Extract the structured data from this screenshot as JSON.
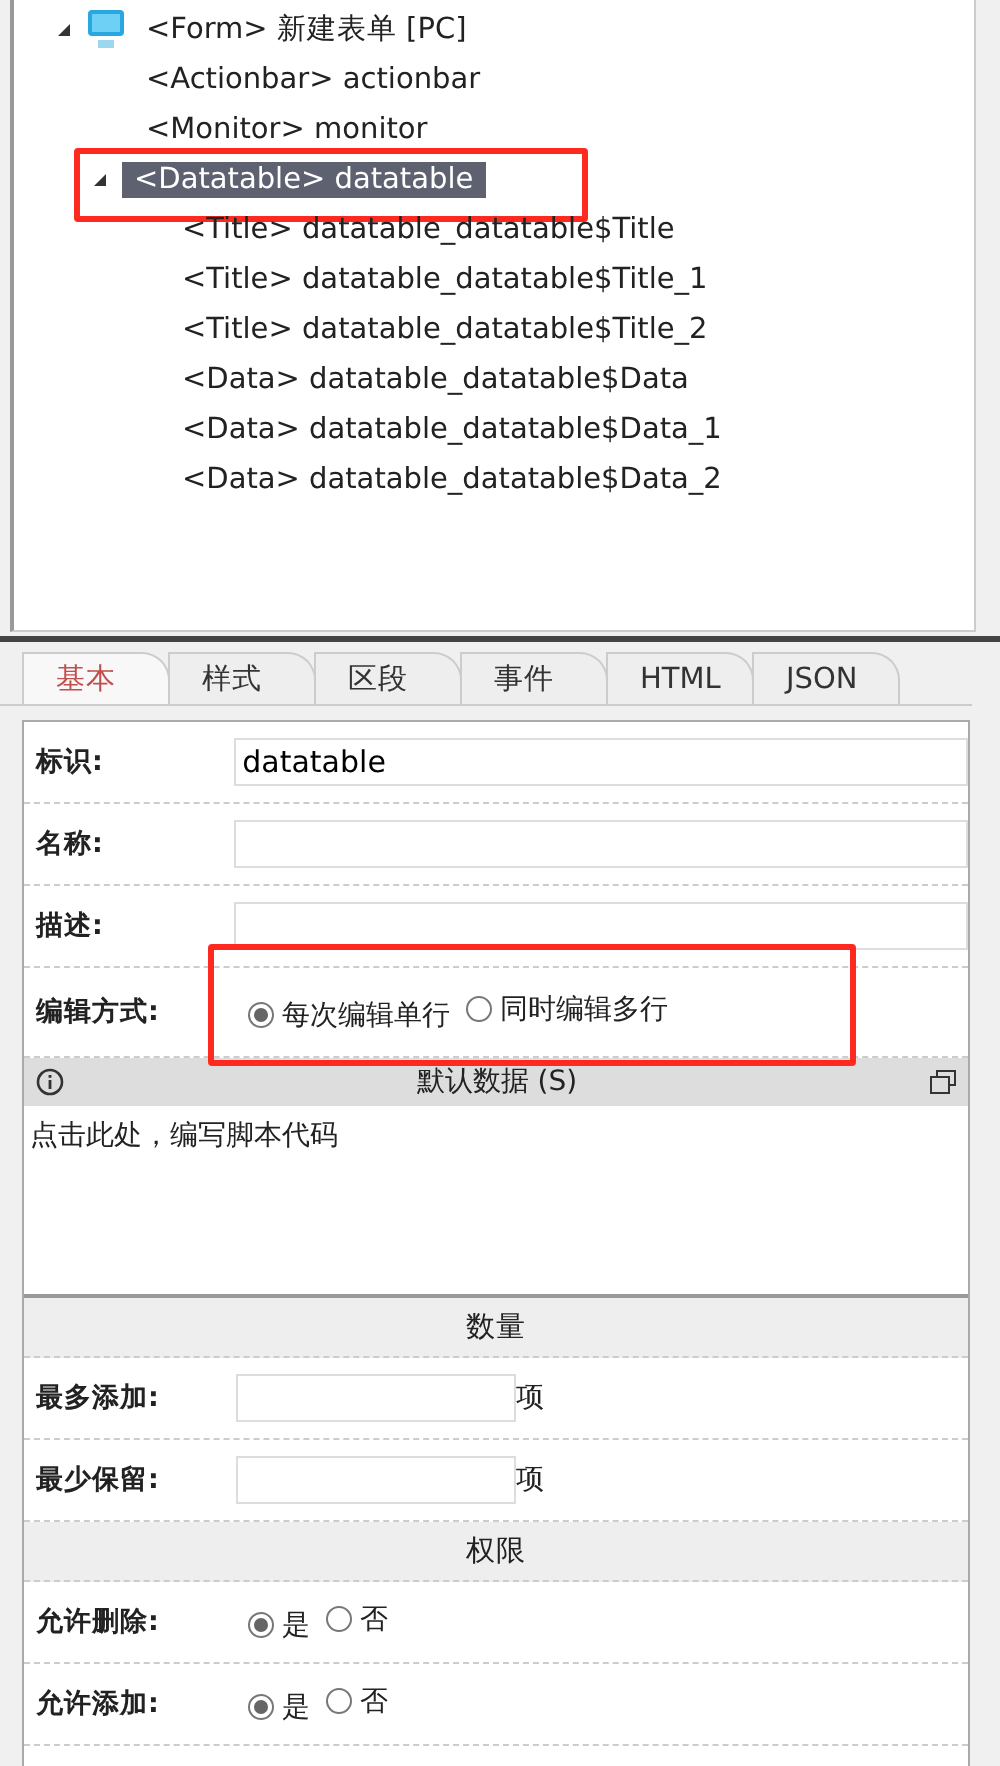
{
  "tree": {
    "items": [
      {
        "label": "<Form> 新建表单 [PC]",
        "expanded": true,
        "selected": false,
        "highlighted": false,
        "children": [
          {
            "label": "<Actionbar> actionbar",
            "selected": false,
            "highlighted": false
          },
          {
            "label": "<Monitor> monitor",
            "selected": false,
            "highlighted": false
          },
          {
            "label": "<Datatable> datatable",
            "expanded": true,
            "selected": true,
            "highlighted": true,
            "children": [
              {
                "label": "<Title> datatable_datatable$Title",
                "selected": false,
                "highlighted": false
              },
              {
                "label": "<Title> datatable_datatable$Title_1",
                "selected": false,
                "highlighted": false
              },
              {
                "label": "<Title> datatable_datatable$Title_2",
                "selected": false,
                "highlighted": false
              },
              {
                "label": "<Data> datatable_datatable$Data",
                "selected": false,
                "highlighted": false
              },
              {
                "label": "<Data> datatable_datatable$Data_1",
                "selected": false,
                "highlighted": false
              },
              {
                "label": "<Data> datatable_datatable$Data_2",
                "selected": false,
                "highlighted": false
              }
            ]
          }
        ]
      }
    ]
  },
  "tabs": [
    {
      "label": "基本",
      "selected": true
    },
    {
      "label": "样式",
      "selected": false
    },
    {
      "label": "区段",
      "selected": false
    },
    {
      "label": "事件",
      "selected": false
    },
    {
      "label": "HTML",
      "selected": false
    },
    {
      "label": "JSON",
      "selected": false
    }
  ],
  "form": {
    "rows": [
      {
        "kind": "text",
        "label": "标识:",
        "value": "datatable"
      },
      {
        "kind": "text",
        "label": "名称:"
      },
      {
        "kind": "text",
        "label": "描述:"
      },
      {
        "kind": "radio",
        "label": "编辑方式:",
        "highlighted": true,
        "options": [
          {
            "label": "每次编辑单行",
            "selected": true
          },
          {
            "label": "同时编辑多行",
            "selected": false
          }
        ]
      },
      {
        "kind": "editor",
        "title": "默认数据 (S)",
        "text": "点击此处，编写脚本代码"
      },
      {
        "kind": "header",
        "title": "数量"
      },
      {
        "kind": "count",
        "label": "最多添加:",
        "unit": "项"
      },
      {
        "kind": "count",
        "label": "最少保留:",
        "unit": "项"
      },
      {
        "kind": "header",
        "title": "权限"
      },
      {
        "kind": "radio",
        "label": "允许删除:",
        "highlighted": false,
        "options": [
          {
            "label": "是",
            "selected": true
          },
          {
            "label": "否",
            "selected": false
          }
        ]
      },
      {
        "kind": "radio",
        "label": "允许添加:",
        "highlighted": false,
        "options": [
          {
            "label": "是",
            "selected": true
          },
          {
            "label": "否",
            "selected": false
          }
        ]
      }
    ]
  }
}
